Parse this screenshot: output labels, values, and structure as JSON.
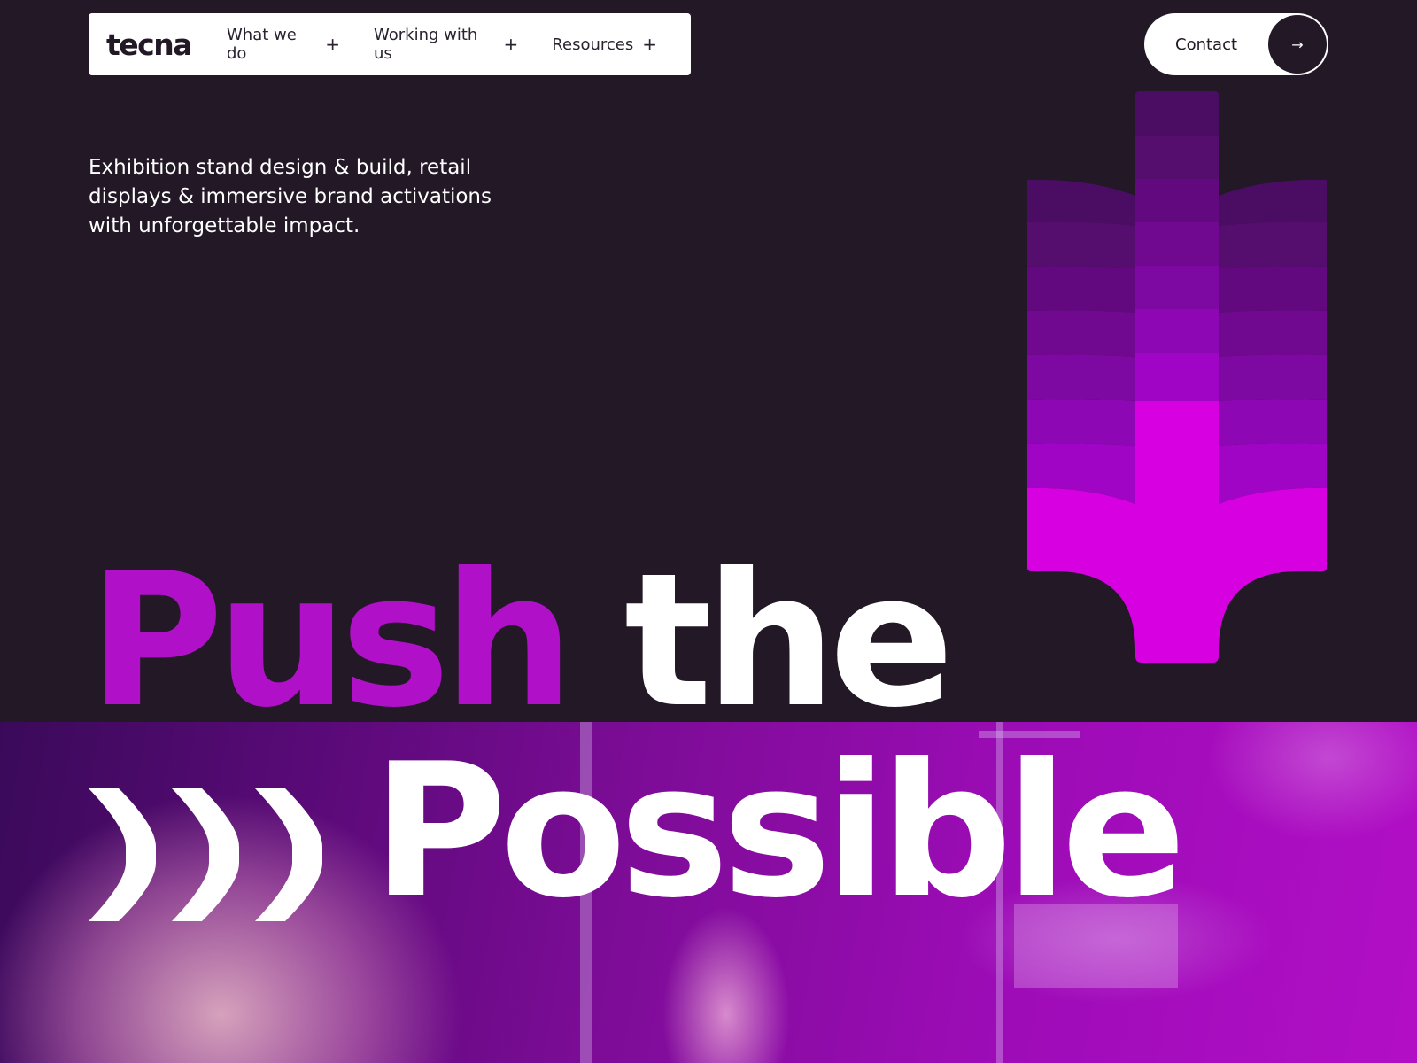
{
  "header": {
    "logo": "tecna",
    "nav": [
      {
        "label": "What we do",
        "icon": "+"
      },
      {
        "label": "Working with us",
        "icon": "+"
      },
      {
        "label": "Resources",
        "icon": "+"
      }
    ],
    "contact": {
      "label": "Contact",
      "icon": "→"
    }
  },
  "hero": {
    "tagline": "Exhibition stand design & build, retail displays & immersive brand activations with unforgettable impact.",
    "headline": {
      "word1": "Push",
      "word2": "the",
      "word3": "Possible"
    }
  },
  "colors": {
    "background": "#221826",
    "accent": "#b010c8",
    "arrow_top": "#4b0d63",
    "arrow_bottom": "#d600e0",
    "nav_background": "#ffffff",
    "text_dark": "#221826"
  },
  "icons": {
    "nav_expand": "plus-icon",
    "contact": "arrow-right-icon",
    "decor_arrow": "down-arrow-icon",
    "decor_chevrons": "chevrons-right-icon"
  }
}
